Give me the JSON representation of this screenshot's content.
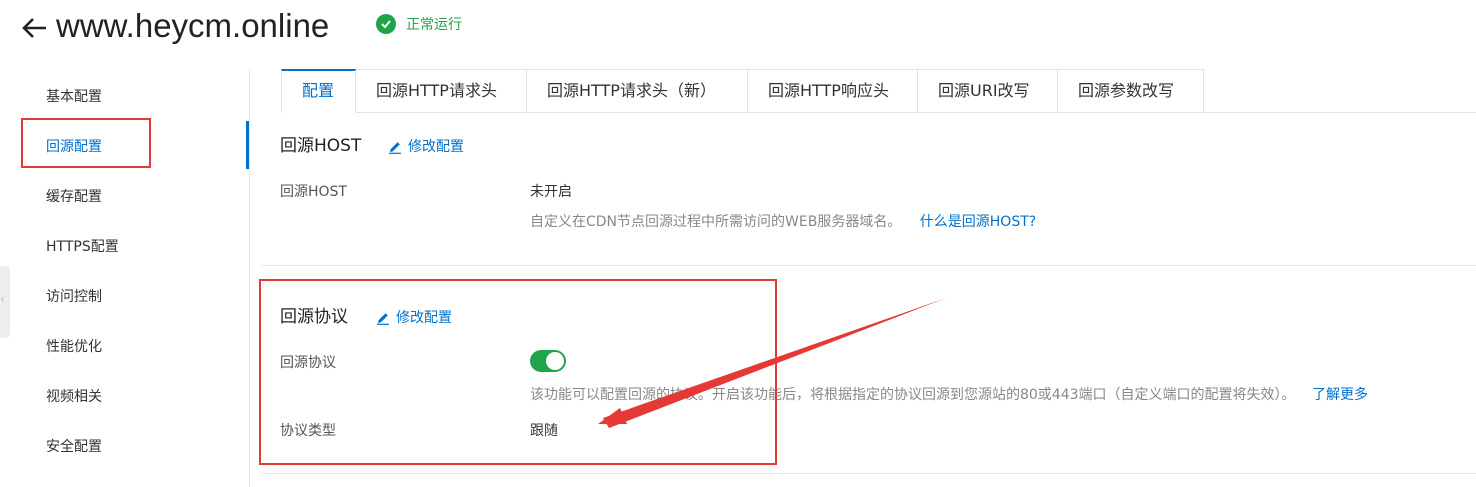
{
  "header": {
    "domain": "www.heycm.online",
    "status": "正常运行",
    "status_color": "#1fa44a"
  },
  "sidebar": {
    "items": [
      {
        "label": "基本配置",
        "active": false
      },
      {
        "label": "回源配置",
        "active": true
      },
      {
        "label": "缓存配置",
        "active": false
      },
      {
        "label": "HTTPS配置",
        "active": false
      },
      {
        "label": "访问控制",
        "active": false
      },
      {
        "label": "性能优化",
        "active": false
      },
      {
        "label": "视频相关",
        "active": false
      },
      {
        "label": "安全配置",
        "active": false
      }
    ]
  },
  "tabs": [
    {
      "label": "配置",
      "active": true
    },
    {
      "label": "回源HTTP请求头",
      "active": false
    },
    {
      "label": "回源HTTP请求头（新）",
      "active": false
    },
    {
      "label": "回源HTTP响应头",
      "active": false
    },
    {
      "label": "回源URI改写",
      "active": false
    },
    {
      "label": "回源参数改写",
      "active": false
    }
  ],
  "host_section": {
    "title": "回源HOST",
    "edit_label": "修改配置",
    "field_label": "回源HOST",
    "field_value": "未开启",
    "help_text": "自定义在CDN节点回源过程中所需访问的WEB服务器域名。",
    "help_link": "什么是回源HOST?"
  },
  "protocol_section": {
    "title": "回源协议",
    "edit_label": "修改配置",
    "field_label": "回源协议",
    "toggle_on": true,
    "help_text": "该功能可以配置回源的协议。开启该功能后，将根据指定的协议回源到您源站的80或443端口（自定义端口的配置将失效）。",
    "help_link": "了解更多",
    "type_label": "协议类型",
    "type_value": "跟随"
  },
  "colors": {
    "accent": "#0070cc",
    "success": "#1fa44a",
    "annotation": "#e53935"
  }
}
